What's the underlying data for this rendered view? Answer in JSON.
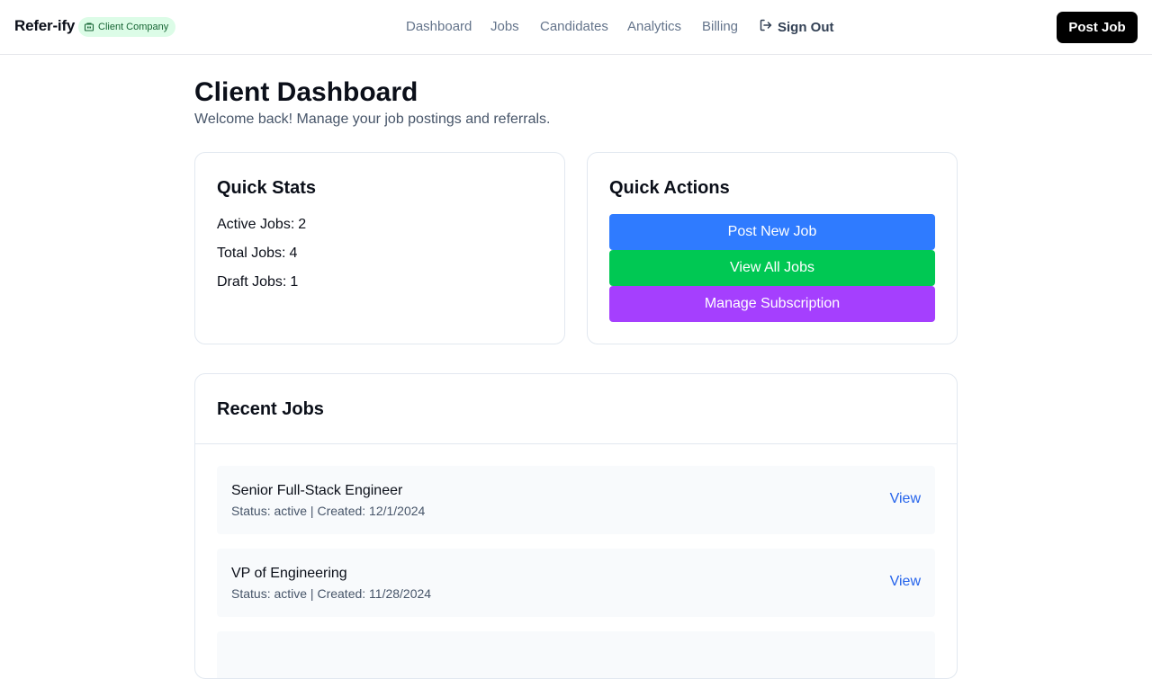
{
  "header": {
    "brand": "Refer-ify",
    "badge_label": "Client Company",
    "nav": [
      "Dashboard",
      "Jobs",
      "Candidates",
      "Analytics",
      "Billing"
    ],
    "sign_out_label": "Sign Out",
    "post_job_label": "Post Job"
  },
  "page": {
    "title": "Client Dashboard",
    "subtitle": "Welcome back! Manage your job postings and referrals."
  },
  "quick_stats": {
    "title": "Quick Stats",
    "items": [
      {
        "label": "Active Jobs:",
        "value": "2"
      },
      {
        "label": "Total Jobs:",
        "value": "4"
      },
      {
        "label": "Draft Jobs:",
        "value": "1"
      }
    ]
  },
  "quick_actions": {
    "title": "Quick Actions",
    "buttons": [
      {
        "label": "Post New Job",
        "color": "#2f7bff"
      },
      {
        "label": "View All Jobs",
        "color": "#00c853"
      },
      {
        "label": "Manage Subscription",
        "color": "#a53ffe"
      }
    ]
  },
  "recent_jobs": {
    "title": "Recent Jobs",
    "items": [
      {
        "title": "Senior Full-Stack Engineer",
        "meta": "Status: active | Created: 12/1/2024",
        "action": "View"
      },
      {
        "title": "VP of Engineering",
        "meta": "Status: active | Created: 11/28/2024",
        "action": "View"
      }
    ]
  },
  "icons": {
    "badge_icon": "building-icon",
    "sign_out_icon": "sign-out-icon"
  }
}
